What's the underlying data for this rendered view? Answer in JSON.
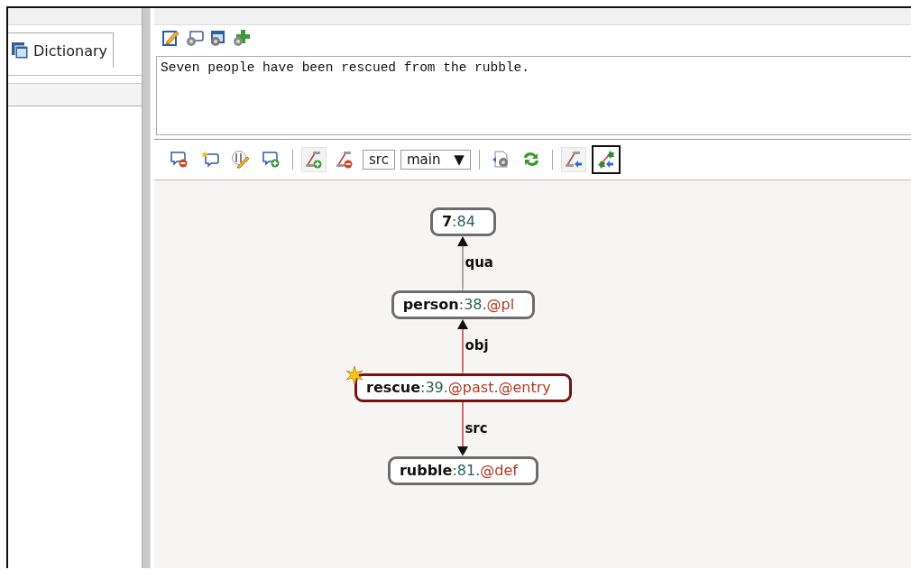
{
  "dictionary_tab": {
    "label": "Dictionary",
    "selected": true
  },
  "editor_toolbar": [
    {
      "kind": "edit"
    },
    {
      "kind": "bubble-gear"
    },
    {
      "kind": "window-gear"
    },
    {
      "kind": "plus-gear"
    }
  ],
  "editor": {
    "value": "Seven people have been rescued from the rubble."
  },
  "graph_toolbar": [
    {
      "kind": "bubble-minus",
      "selected": false
    },
    {
      "kind": "bubble-star",
      "selected": false
    },
    {
      "kind": "pencil-tool",
      "selected": false
    },
    {
      "kind": "bubble-plus",
      "selected": false
    },
    {
      "kind": "separator"
    },
    {
      "kind": "edge-plus",
      "selected": false
    },
    {
      "kind": "edge-minus",
      "selected": false
    },
    {
      "kind": "field",
      "value": "src"
    },
    {
      "kind": "dropdown",
      "value": "main",
      "caret": "▼"
    },
    {
      "kind": "separator"
    },
    {
      "kind": "doc-gear",
      "selected": false
    },
    {
      "kind": "refresh",
      "selected": false
    },
    {
      "kind": "separator"
    },
    {
      "kind": "edge-arrow",
      "selected": false
    },
    {
      "kind": "tree-arrow",
      "selected": true
    }
  ],
  "graph": {
    "nodes": [
      {
        "segments": [
          {
            "kind": "lemma",
            "text": "7"
          },
          {
            "kind": "index",
            "text": ":84"
          }
        ],
        "selected": false,
        "new": false
      },
      {
        "segments": [
          {
            "kind": "lemma",
            "text": "person"
          },
          {
            "kind": "index",
            "text": ":38."
          },
          {
            "kind": "attr",
            "text": "@pl"
          }
        ],
        "selected": false,
        "new": false
      },
      {
        "segments": [
          {
            "kind": "lemma",
            "text": "rescue"
          },
          {
            "kind": "index",
            "text": ":39."
          },
          {
            "kind": "attr",
            "text": "@past"
          },
          {
            "kind": "index",
            "text": "."
          },
          {
            "kind": "attr",
            "text": "@entry"
          }
        ],
        "selected": true,
        "new": true
      },
      {
        "segments": [
          {
            "kind": "lemma",
            "text": "rubble"
          },
          {
            "kind": "index",
            "text": ":81."
          },
          {
            "kind": "attr",
            "text": "@def"
          }
        ],
        "selected": false,
        "new": false
      }
    ],
    "edges": [
      {
        "label": "qua",
        "points_up": true,
        "color": "#a8a8a8"
      },
      {
        "label": "obj",
        "points_up": true,
        "color": "#d06a6a"
      },
      {
        "label": "src",
        "points_up": false,
        "color": "#d06a6a"
      }
    ]
  }
}
